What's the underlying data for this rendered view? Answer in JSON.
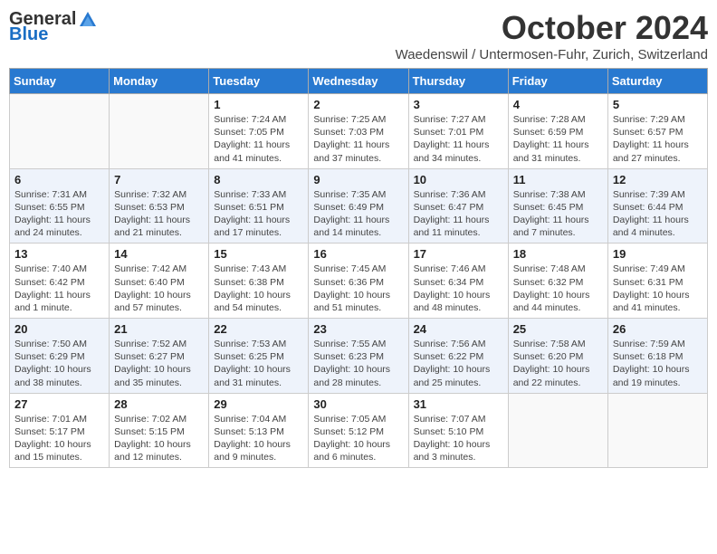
{
  "header": {
    "logo_general": "General",
    "logo_blue": "Blue",
    "title": "October 2024",
    "subtitle": "Waedenswil / Untermosen-Fuhr, Zurich, Switzerland"
  },
  "weekdays": [
    "Sunday",
    "Monday",
    "Tuesday",
    "Wednesday",
    "Thursday",
    "Friday",
    "Saturday"
  ],
  "weeks": [
    [
      {
        "day": "",
        "info": ""
      },
      {
        "day": "",
        "info": ""
      },
      {
        "day": "1",
        "info": "Sunrise: 7:24 AM\nSunset: 7:05 PM\nDaylight: 11 hours and 41 minutes."
      },
      {
        "day": "2",
        "info": "Sunrise: 7:25 AM\nSunset: 7:03 PM\nDaylight: 11 hours and 37 minutes."
      },
      {
        "day": "3",
        "info": "Sunrise: 7:27 AM\nSunset: 7:01 PM\nDaylight: 11 hours and 34 minutes."
      },
      {
        "day": "4",
        "info": "Sunrise: 7:28 AM\nSunset: 6:59 PM\nDaylight: 11 hours and 31 minutes."
      },
      {
        "day": "5",
        "info": "Sunrise: 7:29 AM\nSunset: 6:57 PM\nDaylight: 11 hours and 27 minutes."
      }
    ],
    [
      {
        "day": "6",
        "info": "Sunrise: 7:31 AM\nSunset: 6:55 PM\nDaylight: 11 hours and 24 minutes."
      },
      {
        "day": "7",
        "info": "Sunrise: 7:32 AM\nSunset: 6:53 PM\nDaylight: 11 hours and 21 minutes."
      },
      {
        "day": "8",
        "info": "Sunrise: 7:33 AM\nSunset: 6:51 PM\nDaylight: 11 hours and 17 minutes."
      },
      {
        "day": "9",
        "info": "Sunrise: 7:35 AM\nSunset: 6:49 PM\nDaylight: 11 hours and 14 minutes."
      },
      {
        "day": "10",
        "info": "Sunrise: 7:36 AM\nSunset: 6:47 PM\nDaylight: 11 hours and 11 minutes."
      },
      {
        "day": "11",
        "info": "Sunrise: 7:38 AM\nSunset: 6:45 PM\nDaylight: 11 hours and 7 minutes."
      },
      {
        "day": "12",
        "info": "Sunrise: 7:39 AM\nSunset: 6:44 PM\nDaylight: 11 hours and 4 minutes."
      }
    ],
    [
      {
        "day": "13",
        "info": "Sunrise: 7:40 AM\nSunset: 6:42 PM\nDaylight: 11 hours and 1 minute."
      },
      {
        "day": "14",
        "info": "Sunrise: 7:42 AM\nSunset: 6:40 PM\nDaylight: 10 hours and 57 minutes."
      },
      {
        "day": "15",
        "info": "Sunrise: 7:43 AM\nSunset: 6:38 PM\nDaylight: 10 hours and 54 minutes."
      },
      {
        "day": "16",
        "info": "Sunrise: 7:45 AM\nSunset: 6:36 PM\nDaylight: 10 hours and 51 minutes."
      },
      {
        "day": "17",
        "info": "Sunrise: 7:46 AM\nSunset: 6:34 PM\nDaylight: 10 hours and 48 minutes."
      },
      {
        "day": "18",
        "info": "Sunrise: 7:48 AM\nSunset: 6:32 PM\nDaylight: 10 hours and 44 minutes."
      },
      {
        "day": "19",
        "info": "Sunrise: 7:49 AM\nSunset: 6:31 PM\nDaylight: 10 hours and 41 minutes."
      }
    ],
    [
      {
        "day": "20",
        "info": "Sunrise: 7:50 AM\nSunset: 6:29 PM\nDaylight: 10 hours and 38 minutes."
      },
      {
        "day": "21",
        "info": "Sunrise: 7:52 AM\nSunset: 6:27 PM\nDaylight: 10 hours and 35 minutes."
      },
      {
        "day": "22",
        "info": "Sunrise: 7:53 AM\nSunset: 6:25 PM\nDaylight: 10 hours and 31 minutes."
      },
      {
        "day": "23",
        "info": "Sunrise: 7:55 AM\nSunset: 6:23 PM\nDaylight: 10 hours and 28 minutes."
      },
      {
        "day": "24",
        "info": "Sunrise: 7:56 AM\nSunset: 6:22 PM\nDaylight: 10 hours and 25 minutes."
      },
      {
        "day": "25",
        "info": "Sunrise: 7:58 AM\nSunset: 6:20 PM\nDaylight: 10 hours and 22 minutes."
      },
      {
        "day": "26",
        "info": "Sunrise: 7:59 AM\nSunset: 6:18 PM\nDaylight: 10 hours and 19 minutes."
      }
    ],
    [
      {
        "day": "27",
        "info": "Sunrise: 7:01 AM\nSunset: 5:17 PM\nDaylight: 10 hours and 15 minutes."
      },
      {
        "day": "28",
        "info": "Sunrise: 7:02 AM\nSunset: 5:15 PM\nDaylight: 10 hours and 12 minutes."
      },
      {
        "day": "29",
        "info": "Sunrise: 7:04 AM\nSunset: 5:13 PM\nDaylight: 10 hours and 9 minutes."
      },
      {
        "day": "30",
        "info": "Sunrise: 7:05 AM\nSunset: 5:12 PM\nDaylight: 10 hours and 6 minutes."
      },
      {
        "day": "31",
        "info": "Sunrise: 7:07 AM\nSunset: 5:10 PM\nDaylight: 10 hours and 3 minutes."
      },
      {
        "day": "",
        "info": ""
      },
      {
        "day": "",
        "info": ""
      }
    ]
  ]
}
